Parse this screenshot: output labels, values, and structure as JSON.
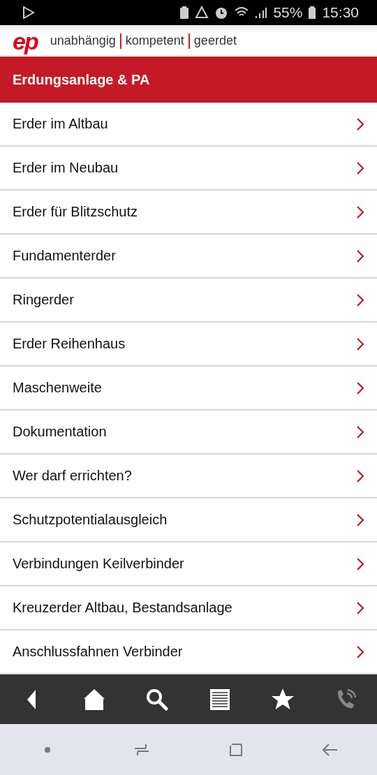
{
  "status_bar": {
    "battery": "55%",
    "time": "15:30"
  },
  "brand": {
    "logo": "ep",
    "tagline": [
      "unabhängig",
      "kompetent",
      "geerdet"
    ]
  },
  "title": "Erdungsanlage & PA",
  "items": [
    {
      "label": "Erder im Altbau"
    },
    {
      "label": "Erder im Neubau"
    },
    {
      "label": "Erder für Blitzschutz"
    },
    {
      "label": "Fundamenterder"
    },
    {
      "label": "Ringerder"
    },
    {
      "label": "Erder Reihenhaus"
    },
    {
      "label": "Maschenweite"
    },
    {
      "label": "Dokumentation"
    },
    {
      "label": "Wer darf errichten?"
    },
    {
      "label": "Schutzpotentialausgleich"
    },
    {
      "label": "Verbindungen Keilverbinder"
    },
    {
      "label": "Kreuzerder Altbau, Bestandsanlage"
    },
    {
      "label": "Anschlussfahnen Verbinder"
    }
  ],
  "toolbar": [
    {
      "kind": "back",
      "disabled": false
    },
    {
      "kind": "home",
      "disabled": false
    },
    {
      "kind": "search",
      "disabled": false
    },
    {
      "kind": "list",
      "disabled": false
    },
    {
      "kind": "star",
      "disabled": false
    },
    {
      "kind": "phone",
      "disabled": true
    }
  ]
}
